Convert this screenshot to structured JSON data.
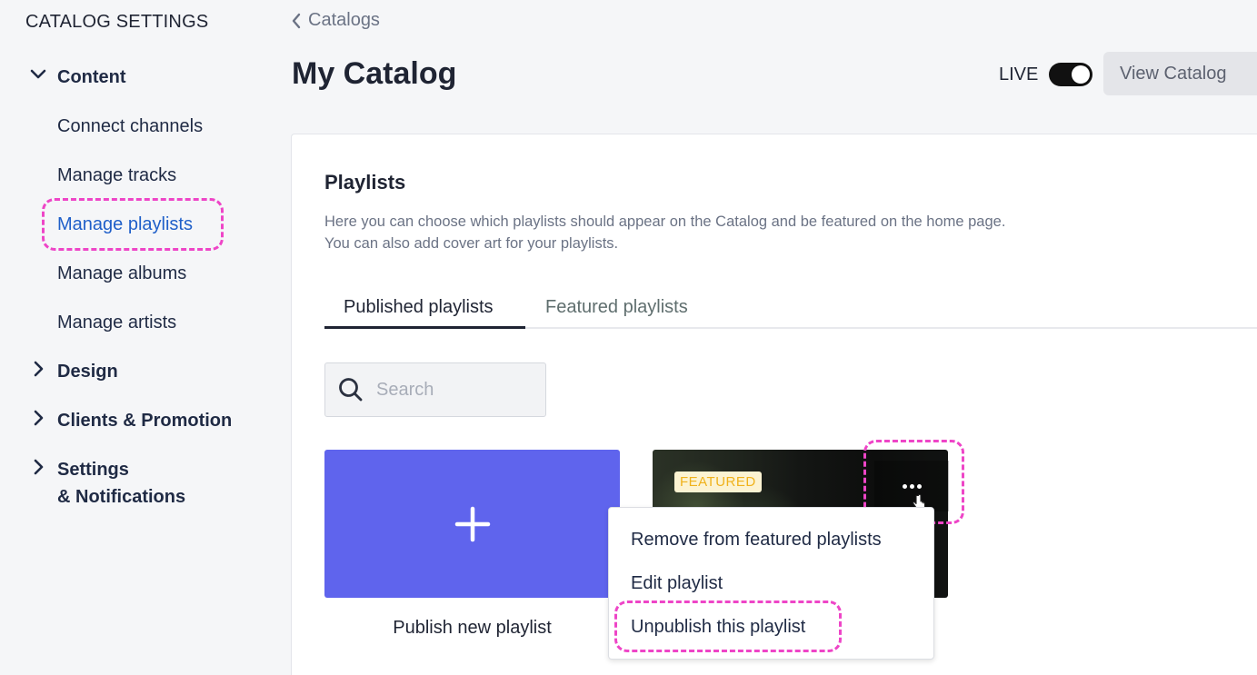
{
  "sidebar": {
    "title": "CATALOG SETTINGS",
    "sections": [
      {
        "label": "Content",
        "expanded": true,
        "icon": "chevron-down-icon"
      },
      {
        "label": "Design",
        "expanded": false,
        "icon": "chevron-right-icon"
      },
      {
        "label": "Clients & Promotion",
        "expanded": false,
        "icon": "chevron-right-icon"
      },
      {
        "label_line1": "Settings",
        "label_line2": "& Notifications",
        "expanded": false,
        "icon": "chevron-right-icon"
      }
    ],
    "content_items": [
      {
        "label": "Connect channels"
      },
      {
        "label": "Manage tracks"
      },
      {
        "label": "Manage playlists",
        "active": true
      },
      {
        "label": "Manage albums"
      },
      {
        "label": "Manage artists"
      }
    ]
  },
  "header": {
    "back_label": "Catalogs",
    "title": "My Catalog",
    "live_label": "LIVE",
    "live_enabled": true,
    "view_button": "View Catalog"
  },
  "playlists": {
    "title": "Playlists",
    "description_line1": "Here you can choose which playlists should appear on the Catalog and be featured on the home page.",
    "description_line2": "You can also add cover art for your playlists.",
    "tabs": [
      {
        "label": "Published playlists",
        "active": true
      },
      {
        "label": "Featured playlists",
        "active": false
      }
    ],
    "search_placeholder": "Search",
    "new_tile_label": "Publish new playlist",
    "featured_badge": "FEATURED",
    "menu": [
      {
        "label": "Remove from featured playlists"
      },
      {
        "label": "Edit playlist"
      },
      {
        "label": "Unpublish this playlist"
      }
    ]
  },
  "colors": {
    "accent": "#5f64ed",
    "highlight": "#ee45c7",
    "active_link": "#1f5fc9",
    "featured_badge_text": "#f0b21c"
  }
}
